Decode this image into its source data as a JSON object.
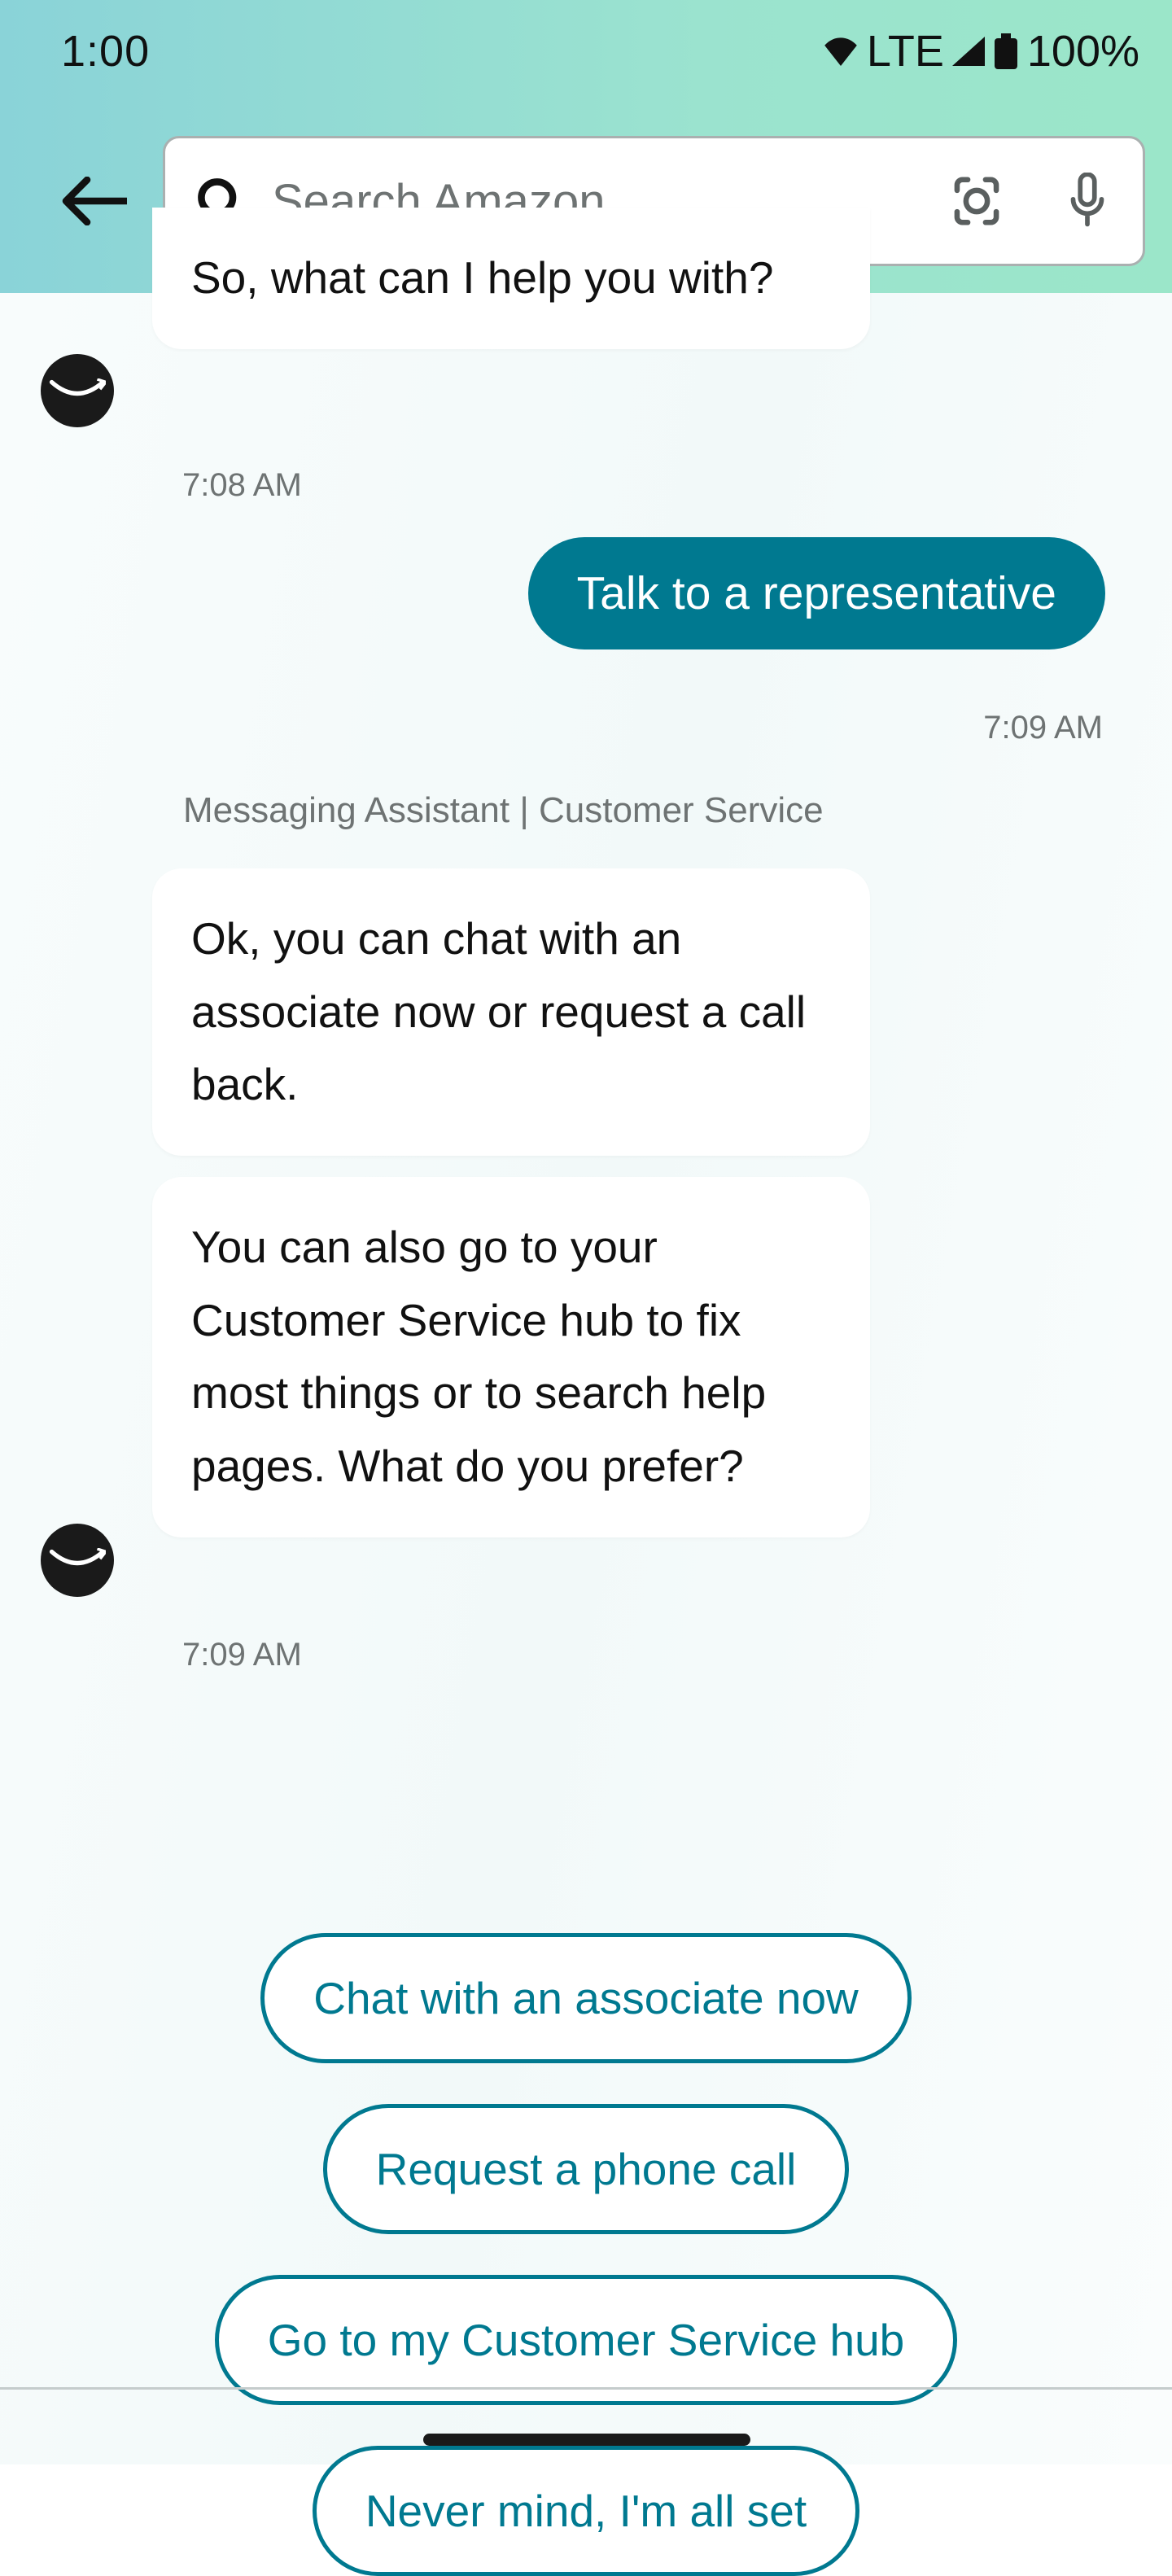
{
  "status": {
    "time": "1:00",
    "network": "LTE",
    "battery": "100%"
  },
  "search": {
    "placeholder": "Search Amazon"
  },
  "chat": {
    "firstBubbleText": "So, what can I help you with?",
    "firstTimestamp": "7:08 AM",
    "userMessage": "Talk to a representative",
    "userTimestamp": "7:09 AM",
    "assistantLabel": "Messaging Assistant | Customer Service",
    "reply1": "Ok, you can chat with an associate now or request a call back.",
    "reply2": "You can also go to your Customer Service hub to fix most things or to search help pages. What do you prefer?",
    "replyTimestamp": "7:09 AM"
  },
  "options": {
    "chatNow": "Chat with an associate now",
    "phone": "Request a phone call",
    "hub": "Go to my Customer Service hub",
    "never": "Never mind, I'm all set"
  }
}
